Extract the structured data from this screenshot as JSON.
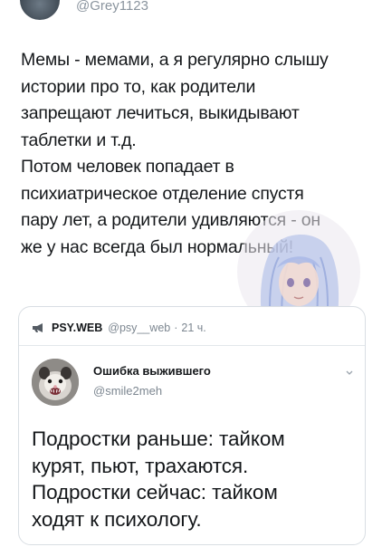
{
  "header": {
    "handle": "@Grey1123"
  },
  "tweet": {
    "text": "Мемы - мемами, а я регулярно слышу\nистории про то, как родители\nзапрещают лечиться, выкидывают\nтаблетки и т.д.\nПотом человек попадает в\nпсихиатрическое отделение спустя\nпару лет, а родители удивляются - он\nже у нас всегда был нормальный!"
  },
  "quoted": {
    "header": {
      "icon": "bullhorn-icon",
      "name": "PSY.WEB",
      "handle": "@psy__web",
      "dot": "·",
      "time": "21 ч."
    },
    "inner": {
      "name": "Ошибка выжившего",
      "handle": "@smile2meh",
      "text": "Подростки раньше: тайком\nкурят, пьют, трахаются.\nПодростки сейчас: тайком\nходят к психологу."
    }
  },
  "colors": {
    "text": "#14171a",
    "secondary": "#8a949e",
    "border": "#d9dee3"
  }
}
